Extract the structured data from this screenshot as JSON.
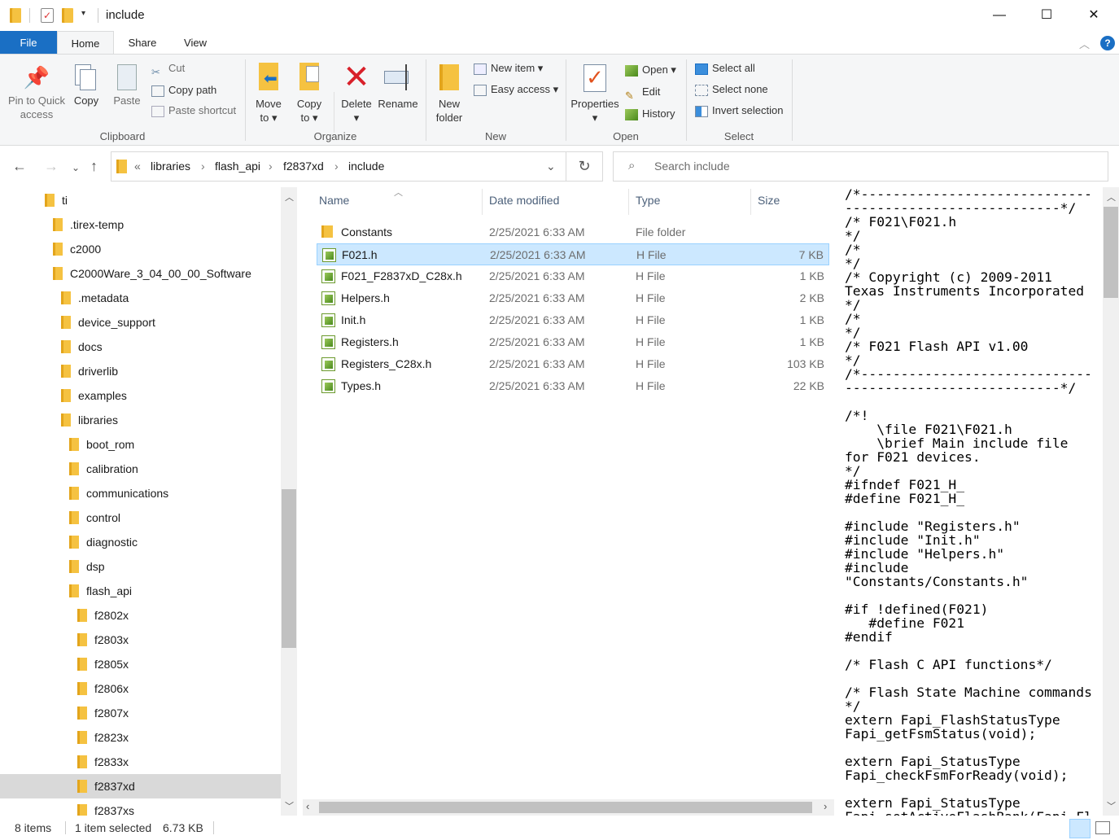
{
  "window": {
    "title": "include",
    "controls": {
      "minimize": "—",
      "maximize": "☐",
      "close": "✕"
    }
  },
  "ribbon_tabs": {
    "file": "File",
    "home": "Home",
    "share": "Share",
    "view": "View"
  },
  "ribbon": {
    "clipboard": {
      "label": "Clipboard",
      "pin_line1": "Pin to Quick",
      "pin_line2": "access",
      "copy": "Copy",
      "paste": "Paste",
      "cut": "Cut",
      "copy_path": "Copy path",
      "paste_shortcut": "Paste shortcut"
    },
    "organize": {
      "label": "Organize",
      "move_line1": "Move",
      "move_line2": "to ▾",
      "copy_line1": "Copy",
      "copy_line2": "to ▾",
      "delete_line1": "Delete",
      "delete_line2": "▾",
      "rename": "Rename"
    },
    "new": {
      "label": "New",
      "folder_line1": "New",
      "folder_line2": "folder",
      "new_item": "New item ▾",
      "easy_access": "Easy access ▾"
    },
    "open": {
      "label": "Open",
      "props_line1": "Properties",
      "props_line2": "▾",
      "open": "Open ▾",
      "edit": "Edit",
      "history": "History"
    },
    "select": {
      "label": "Select",
      "select_all": "Select all",
      "select_none": "Select none",
      "invert": "Invert selection"
    }
  },
  "address": {
    "sep": "«",
    "crumbs": [
      "libraries",
      "flash_api",
      "f2837xd",
      "include"
    ]
  },
  "search": {
    "placeholder": "Search include"
  },
  "tree": [
    "ti",
    ".tirex-temp",
    "c2000",
    "C2000Ware_3_04_00_00_Software",
    ".metadata",
    "device_support",
    "docs",
    "driverlib",
    "examples",
    "libraries",
    "boot_rom",
    "calibration",
    "communications",
    "control",
    "diagnostic",
    "dsp",
    "flash_api",
    "f2802x",
    "f2803x",
    "f2805x",
    "f2806x",
    "f2807x",
    "f2823x",
    "f2833x",
    "f2837xd",
    "f2837xs"
  ],
  "tree_selected_index": 24,
  "columns": {
    "name": "Name",
    "date": "Date modified",
    "type": "Type",
    "size": "Size"
  },
  "files": [
    {
      "name": "Constants",
      "date": "2/25/2021 6:33 AM",
      "type": "File folder",
      "size": "",
      "icon": "folder-icon"
    },
    {
      "name": "F021.h",
      "date": "2/25/2021 6:33 AM",
      "type": "H File",
      "size": "7 KB",
      "icon": "h-file-icon"
    },
    {
      "name": "F021_F2837xD_C28x.h",
      "date": "2/25/2021 6:33 AM",
      "type": "H File",
      "size": "1 KB",
      "icon": "h-file-icon"
    },
    {
      "name": "Helpers.h",
      "date": "2/25/2021 6:33 AM",
      "type": "H File",
      "size": "2 KB",
      "icon": "h-file-icon"
    },
    {
      "name": "Init.h",
      "date": "2/25/2021 6:33 AM",
      "type": "H File",
      "size": "1 KB",
      "icon": "h-file-icon"
    },
    {
      "name": "Registers.h",
      "date": "2/25/2021 6:33 AM",
      "type": "H File",
      "size": "1 KB",
      "icon": "h-file-icon"
    },
    {
      "name": "Registers_C28x.h",
      "date": "2/25/2021 6:33 AM",
      "type": "H File",
      "size": "103 KB",
      "icon": "h-file-icon"
    },
    {
      "name": "Types.h",
      "date": "2/25/2021 6:33 AM",
      "type": "H File",
      "size": "22 KB",
      "icon": "h-file-icon"
    }
  ],
  "selected_file_index": 1,
  "preview_text": "/*-----------------------------\n---------------------------*/\n/* F021\\F021.h\n*/\n/*\n*/\n/* Copyright (c) 2009-2011\nTexas Instruments Incorporated\n*/\n/*\n*/\n/* F021 Flash API v1.00\n*/\n/*-----------------------------\n---------------------------*/\n\n/*!\n    \\file F021\\F021.h\n    \\brief Main include file\nfor F021 devices.\n*/\n#ifndef F021_H_\n#define F021_H_\n\n#include \"Registers.h\"\n#include \"Init.h\"\n#include \"Helpers.h\"\n#include\n\"Constants/Constants.h\"\n\n#if !defined(F021)\n   #define F021\n#endif\n\n/* Flash C API functions*/\n\n/* Flash State Machine commands\n*/\nextern Fapi_FlashStatusType\nFapi_getFsmStatus(void);\n\nextern Fapi_StatusType\nFapi_checkFsmForReady(void);\n\nextern Fapi_StatusType\nFapi_setActiveFlashBank(Fapi_Fl",
  "status": {
    "items": "8 items",
    "selected": "1 item selected",
    "size": "6.73 KB"
  }
}
